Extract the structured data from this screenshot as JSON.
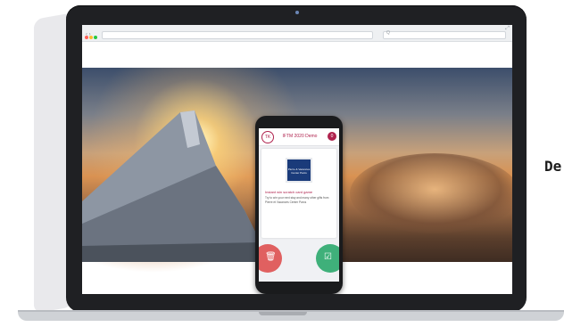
{
  "browser": {
    "search_placeholder": "Q"
  },
  "app": {
    "badge": "TK",
    "title": "IFTM 2020 Demo",
    "counter": "0"
  },
  "card": {
    "logo_text": "Pierre & Vacances Center Parcs",
    "title": "Instant win scratch card game",
    "body": "Try to win your next stay and many other gifts from Pierre et Vacances Center Parcs"
  },
  "buttons": {
    "delete_icon": "trash-icon",
    "confirm_icon": "check-card-icon"
  },
  "side_text": "De",
  "colors": {
    "accent": "#b0234e",
    "delete": "#e06060",
    "confirm": "#3fb07a"
  }
}
